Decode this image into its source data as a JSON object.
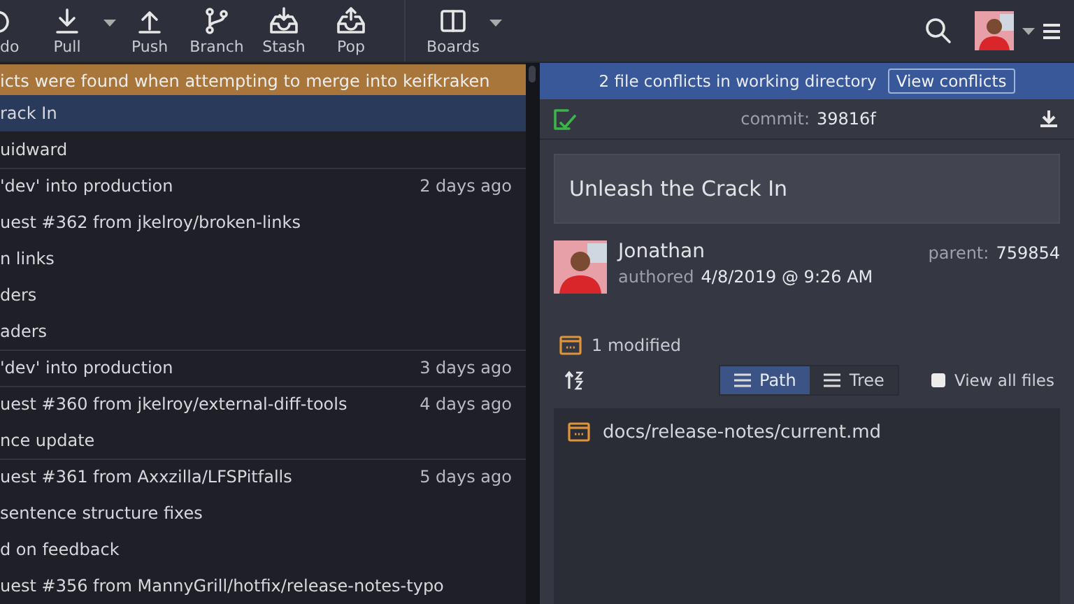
{
  "toolbar": {
    "items": [
      {
        "label": "do",
        "kind": "undo",
        "dropdown": false
      },
      {
        "label": "Pull",
        "kind": "pull",
        "dropdown": true
      },
      {
        "label": "Push",
        "kind": "push",
        "dropdown": false
      },
      {
        "label": "Branch",
        "kind": "branch",
        "dropdown": false
      },
      {
        "label": "Stash",
        "kind": "stash",
        "dropdown": false
      },
      {
        "label": "Pop",
        "kind": "pop",
        "dropdown": false
      },
      {
        "label": "Boards",
        "kind": "boards",
        "dropdown": true,
        "divider_before": true
      }
    ]
  },
  "conflict_banner": {
    "text": "icts were found when attempting to merge into keifkraken"
  },
  "commits": [
    {
      "message": "rack In",
      "selected": true,
      "separator": false
    },
    {
      "message": "uidward",
      "selected": false,
      "separator": false
    },
    {
      "message": "'dev' into production",
      "time": "2 days ago",
      "selected": false,
      "separator": true
    },
    {
      "message": "uest #362 from jkelroy/broken-links",
      "selected": false,
      "separator": false
    },
    {
      "message": "n links",
      "selected": false,
      "separator": false
    },
    {
      "message": "ders",
      "selected": false,
      "separator": false
    },
    {
      "message": "aders",
      "selected": false,
      "separator": false
    },
    {
      "message": "'dev' into production",
      "time": "3 days ago",
      "selected": false,
      "separator": true
    },
    {
      "message": "uest #360 from jkelroy/external-diff-tools",
      "time": "4 days ago",
      "selected": false,
      "separator": true
    },
    {
      "message": "nce update",
      "selected": false,
      "separator": false
    },
    {
      "message": "uest #361 from Axxzilla/LFSPitfalls",
      "time": "5 days ago",
      "selected": false,
      "separator": true
    },
    {
      "message": "sentence structure fixes",
      "selected": false,
      "separator": false
    },
    {
      "message": "d on feedback",
      "selected": false,
      "separator": false
    },
    {
      "message": "uest #356 from MannyGrill/hotfix/release-notes-typo",
      "selected": false,
      "separator": false
    }
  ],
  "working_banner": {
    "text": "2 file conflicts in working directory",
    "button": "View conflicts"
  },
  "commit_header": {
    "label": "commit:",
    "sha": "39816f"
  },
  "commit_message": "Unleash the Crack In",
  "author": {
    "name": "Jonathan",
    "authored_label": "authored",
    "date": "4/8/2019 @ 9:26 AM",
    "parent_label": "parent:",
    "parent_sha": "759854"
  },
  "changes": {
    "summary": "1 modified"
  },
  "view_toggle": [
    {
      "label": "Path",
      "selected": true
    },
    {
      "label": "Tree",
      "selected": false
    }
  ],
  "view_all_files": {
    "label": "View all files",
    "checked": false
  },
  "files": [
    {
      "path": "docs/release-notes/current.md"
    }
  ]
}
